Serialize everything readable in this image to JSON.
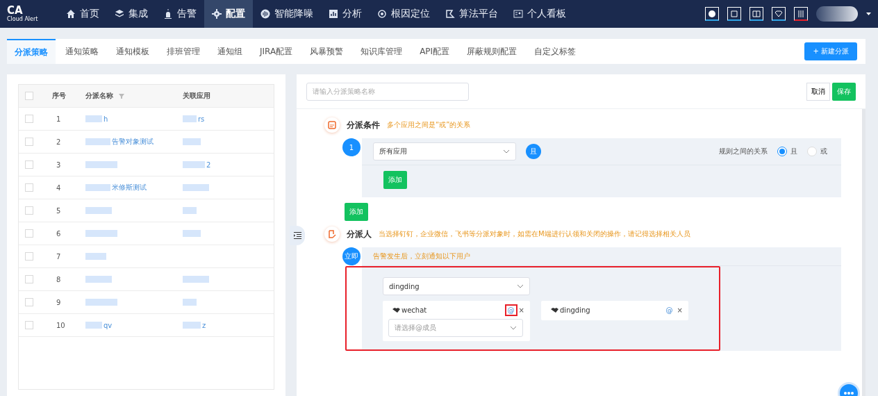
{
  "brand": {
    "title": "CA",
    "subtitle": "Cloud Alert"
  },
  "nav": [
    {
      "label": "首页",
      "selected": false
    },
    {
      "label": "集成",
      "selected": false
    },
    {
      "label": "告警",
      "selected": false
    },
    {
      "label": "配置",
      "selected": true
    },
    {
      "label": "智能降噪",
      "selected": false
    },
    {
      "label": "分析",
      "selected": false
    },
    {
      "label": "根因定位",
      "selected": false
    },
    {
      "label": "算法平台",
      "selected": false
    },
    {
      "label": "个人看板",
      "selected": false
    }
  ],
  "tabs": [
    {
      "label": "分派策略",
      "selected": true
    },
    {
      "label": "通知策略",
      "selected": false
    },
    {
      "label": "通知模板",
      "selected": false
    },
    {
      "label": "排班管理",
      "selected": false
    },
    {
      "label": "通知组",
      "selected": false
    },
    {
      "label": "JIRA配置",
      "selected": false
    },
    {
      "label": "风暴预警",
      "selected": false
    },
    {
      "label": "知识库管理",
      "selected": false
    },
    {
      "label": "API配置",
      "selected": false
    },
    {
      "label": "屏蔽规则配置",
      "selected": false
    },
    {
      "label": "自定义标签",
      "selected": false
    }
  ],
  "new_button": "+ 新建分派",
  "table": {
    "columns": [
      "序号",
      "分派名称",
      "关联应用"
    ],
    "all_checked": false,
    "rows": [
      {
        "index": "1",
        "name": "h",
        "app": "rs",
        "checked": false
      },
      {
        "index": "2",
        "name": "告警对象测试",
        "checked": false
      },
      {
        "index": "3",
        "app": "2",
        "checked": false
      },
      {
        "index": "4",
        "name": "米修斯测试",
        "checked": false
      },
      {
        "index": "5",
        "checked": false
      },
      {
        "index": "6",
        "checked": false
      },
      {
        "index": "7",
        "checked": false
      },
      {
        "index": "8",
        "checked": false
      },
      {
        "index": "9",
        "checked": false
      },
      {
        "index": "10",
        "name": "qv",
        "app": "z",
        "checked": false
      }
    ]
  },
  "editor": {
    "name_placeholder": "请输入分派策略名称",
    "cancel": "取消",
    "save": "保存",
    "conditions": {
      "title": "分派条件",
      "hint": "多个应用之间是“或”的关系",
      "step": "1",
      "app_select": "所有应用",
      "and_badge": "且",
      "relation_label": "规则之间的关系",
      "relations": [
        {
          "label": "且",
          "selected": true
        },
        {
          "label": "或",
          "selected": false
        }
      ],
      "add_inner": "添加",
      "add_outer": "添加"
    },
    "assignees": {
      "title": "分派人",
      "hint": "当选择钉钉，企业微信，飞书等分派对象时，如需在M端进行认领和关闭的操作，请记得选择相关人员",
      "step": "立即",
      "step_hint": "告警发生后，立刻通知以下用户",
      "highlighted": true,
      "channel_select": "dingding",
      "targets": [
        {
          "name": "wechat",
          "at": "@",
          "close": "×",
          "highlighted": true,
          "member_placeholder": "请选择@成员"
        },
        {
          "name": "dingding",
          "at": "@",
          "close": "×",
          "highlighted": false
        }
      ]
    }
  }
}
